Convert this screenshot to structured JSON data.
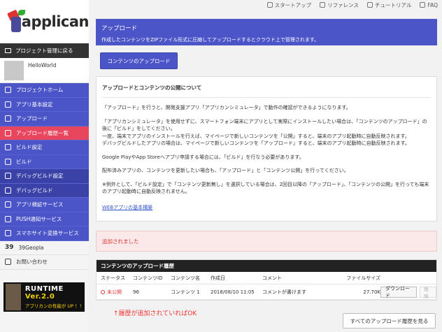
{
  "topnav": [
    {
      "label": "スタートアップ",
      "icon": "home-icon"
    },
    {
      "label": "リファレンス",
      "icon": "book-icon"
    },
    {
      "label": "チュートリアル",
      "icon": "graduation-icon"
    },
    {
      "label": "FAQ",
      "icon": "question-icon"
    }
  ],
  "logo": {
    "text": "applican"
  },
  "sidebar": {
    "back_label": "プロジェクト管理に戻る",
    "project_name": "HelloWorld",
    "items": [
      {
        "label": "プロジェクトホーム",
        "icon": "cube-icon"
      },
      {
        "label": "アプリ基本設定",
        "icon": "gear-icon"
      },
      {
        "label": "アップロード",
        "icon": "upload-icon"
      },
      {
        "label": "アップロード履歴一覧",
        "icon": "history-icon"
      },
      {
        "label": "ビルド設定",
        "icon": "build-settings-icon"
      },
      {
        "label": "ビルド",
        "icon": "build-icon"
      },
      {
        "label": "デバッグビルド設定",
        "icon": "debug-settings-icon"
      },
      {
        "label": "デバッグビルド",
        "icon": "debug-build-icon"
      },
      {
        "label": "アプリ検証サービス",
        "icon": "wrench-icon"
      },
      {
        "label": "PUSH通知サービス",
        "icon": "push-icon"
      },
      {
        "label": "スマホサイト変換サービス",
        "icon": "phone-icon"
      },
      {
        "label": "39Geopla",
        "icon": "39-icon"
      },
      {
        "label": "お問い合わせ",
        "icon": "mail-icon"
      }
    ]
  },
  "banner": {
    "line1_a": "RUNTIME ",
    "line1_b": "Ver.2.0",
    "line2": "アプリカンの性能が UP ！！"
  },
  "header": {
    "title": "アップロード",
    "subtitle": "作成したコンテンツをZIPファイル形式に圧縮してアップロードするとクラウド上で管理されます。"
  },
  "upload_button": "コンテンツのアップロード",
  "info": {
    "title": "アップロードとコンテンツの公開について",
    "p1": "「アップロード」を行うと、開発支援アプリ「アプリカンシミュレータ」で動作の確認ができるようになります。",
    "p2a": "「アプリカンシミュレータ」を使用せずに、スマートフォン端末にアプリとして実際にインストールしたい場合は、「コンテンツのアップロード」の後に「ビルド」をしてください。",
    "p2b": "一度、端末でアプリのインストールを行えば、マイページで新しいコンテンツを「公開」すると、端末のアプリ起動時に自動反映されます。",
    "p2c": "デバッグビルドしたアプリの場合は、マイページで新しいコンテンツを「アップロード」すると、端末のアプリ起動時に自動反映されます。",
    "p3": "Google PlayやApp Storeへアプリ申請する場合には、「ビルド」を行なう必要があります。",
    "p4": "配布済みアプリの、コンテンツを更新したい場合も、「アップロード」と「コンテンツ公開」を行ってください。",
    "p5": "※例外として、「ビルド設定」で「コンテンツ更新無し」を選択している場合は、2回目以降の「アップロード」、「コンテンツの公開」を行っても端末のアプリ起動時に自動反映されません。",
    "link": "WEBアプリの基本構築"
  },
  "alert": "追加されました",
  "history": {
    "title": "コンテンツのアップロード履歴",
    "columns": [
      "ステータス",
      "コンテンツID",
      "コンテンツ名",
      "作成日",
      "コメント",
      "ファイルサイズ"
    ],
    "rows": [
      {
        "status": "未公開",
        "id": "96",
        "name": "コンテンツ 1",
        "date": "2018/08/10 11:05",
        "comment": "コメントが書けます",
        "size": "27.70K"
      }
    ],
    "download_label": "ダウンロード",
    "delete_label": "削除"
  },
  "note": "↑履歴が追加されていればOK",
  "all_history_button": "すべてのアップロード履歴を見る",
  "colors": {
    "accent": "#4b55c8",
    "active": "#e8455e",
    "alert": "#dd3333"
  }
}
